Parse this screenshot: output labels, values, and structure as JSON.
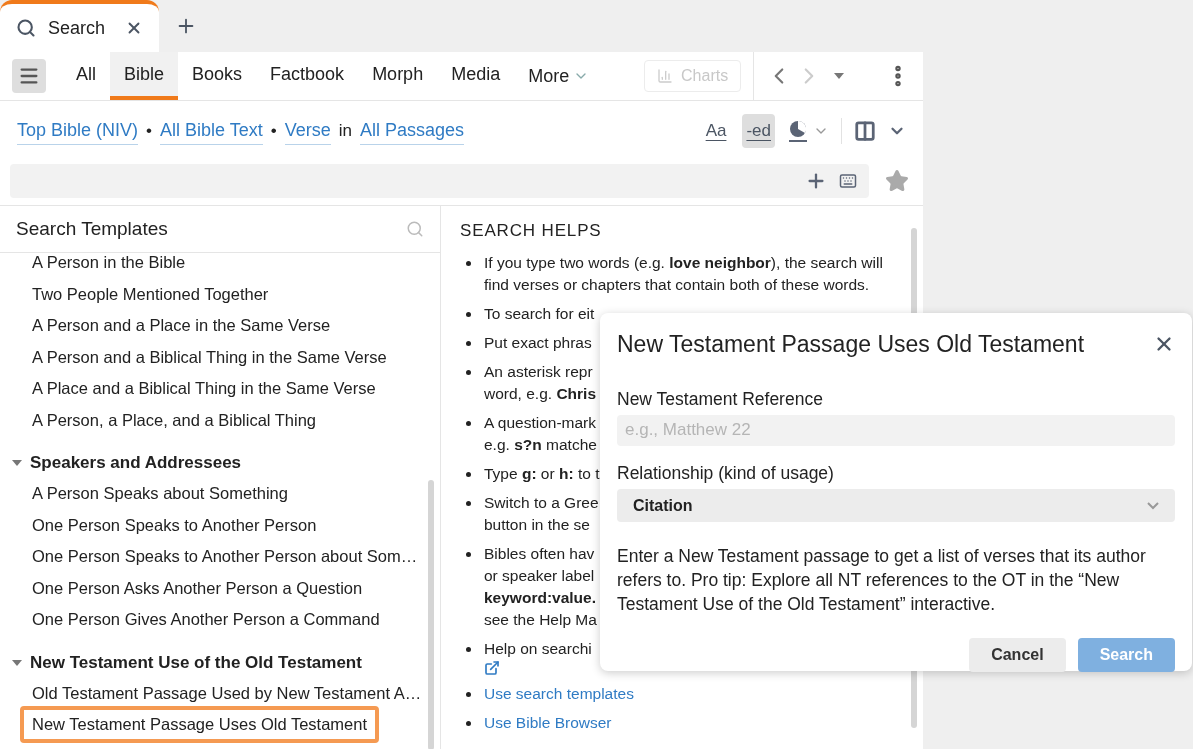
{
  "doc_tabs": [
    {
      "label": "Search",
      "selected": true
    }
  ],
  "nav_tabs": [
    {
      "label": "All",
      "selected": false
    },
    {
      "label": "Bible",
      "selected": true
    },
    {
      "label": "Books",
      "selected": false
    },
    {
      "label": "Factbook",
      "selected": false
    },
    {
      "label": "Morph",
      "selected": false
    },
    {
      "label": "Media",
      "selected": false
    }
  ],
  "more_label": "More",
  "charts_label": "Charts",
  "scope": [
    {
      "kind": "link",
      "text": "Top Bible (NIV)"
    },
    {
      "kind": "sep",
      "text": "•"
    },
    {
      "kind": "link",
      "text": "All Bible Text"
    },
    {
      "kind": "sep",
      "text": "•"
    },
    {
      "kind": "link",
      "text": "Verse"
    },
    {
      "kind": "sep",
      "text": "in"
    },
    {
      "kind": "link",
      "text": "All Passages"
    }
  ],
  "view_tools": [
    {
      "label": "Aa",
      "selected": false
    },
    {
      "label": "-ed",
      "selected": true
    }
  ],
  "templates": {
    "title": "Search Templates",
    "groups": [
      {
        "items": [
          {
            "label": "A Person in the Bible",
            "selected": false
          },
          {
            "label": "Two People Mentioned Together",
            "selected": false
          },
          {
            "label": "A Person and a Place in the Same Verse",
            "selected": false
          },
          {
            "label": "A Person and a Biblical Thing in the Same Verse",
            "selected": false
          },
          {
            "label": "A Place and a Biblical Thing in the Same Verse",
            "selected": false
          },
          {
            "label": "A Person, a Place, and a Biblical Thing",
            "selected": false
          }
        ]
      },
      {
        "label": "Speakers and Addressees",
        "expanded": true,
        "items": [
          {
            "label": "A Person Speaks about Something",
            "selected": false
          },
          {
            "label": "One Person Speaks to Another Person",
            "selected": false
          },
          {
            "label": "One Person Speaks to Another Person about Som…",
            "selected": false
          },
          {
            "label": "One Person Asks Another Person a Question",
            "selected": false
          },
          {
            "label": "One Person Gives Another Person a Command",
            "selected": false
          }
        ]
      },
      {
        "label": "New Testament Use of the Old Testament",
        "expanded": true,
        "items": [
          {
            "label": "Old Testament Passage Used by New Testament A…",
            "selected": false
          },
          {
            "label": "New Testament Passage Uses Old Testament",
            "selected": true
          }
        ]
      }
    ]
  },
  "helps": {
    "title": "SEARCH HELPS",
    "items": [
      {
        "kind": "text",
        "lines": [
          "If you type two words (e.g. **love neighbor**), the search will",
          "find verses or chapters that contain both of these words."
        ]
      },
      {
        "kind": "text",
        "lines": [
          "To search for eit"
        ]
      },
      {
        "kind": "text",
        "lines": [
          "Put exact phras"
        ]
      },
      {
        "kind": "text",
        "lines": [
          "An asterisk repr",
          "word, e.g. **Chris**"
        ]
      },
      {
        "kind": "text",
        "lines": [
          "A question-mark",
          "e.g. **s?n** matche"
        ]
      },
      {
        "kind": "text",
        "lines": [
          "Type **g:** or **h:** to t"
        ]
      },
      {
        "kind": "text",
        "lines": [
          "Switch to a Gree",
          "button in the se"
        ]
      },
      {
        "kind": "text",
        "lines": [
          "Bibles often hav",
          "or speaker label",
          "**keyword:value.**",
          "see the Help Ma"
        ]
      },
      {
        "kind": "external",
        "lines": [
          "Help on searchi"
        ]
      },
      {
        "kind": "link",
        "lines": [
          "Use search templates"
        ]
      },
      {
        "kind": "link",
        "lines": [
          "Use Bible Browser"
        ]
      }
    ]
  },
  "dialog": {
    "title": "New Testament Passage Uses Old Testament",
    "reference_label": "New Testament Reference",
    "reference_placeholder": "e.g., Matthew 22",
    "relationship_label": "Relationship (kind of usage)",
    "relationship_value": "Citation",
    "description": "Enter a New Testament passage to get a list of verses that its author refers to. Pro tip: Explore all NT references to the OT in the “New Testament Use of the Old Testament” interactive.",
    "buttons": [
      {
        "label": "Cancel",
        "disabled": false
      },
      {
        "label": "Search",
        "disabled": true
      }
    ]
  }
}
